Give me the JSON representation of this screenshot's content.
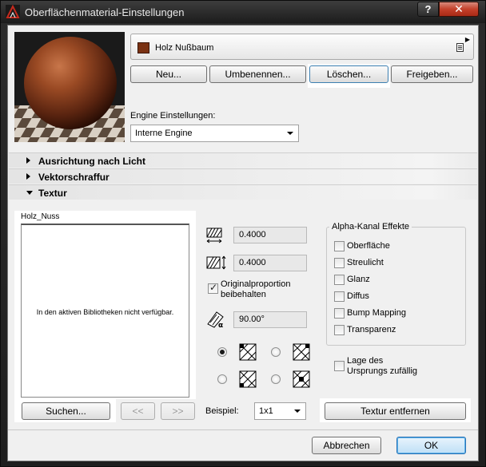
{
  "window": {
    "title": "Oberflächenmaterial-Einstellungen",
    "help_label": "?",
    "close_label": "✕"
  },
  "material": {
    "name": "Holz Nußbaum",
    "swatch_color": "#7a3213"
  },
  "buttons": {
    "new": "Neu...",
    "rename": "Umbenennen...",
    "delete": "Löschen...",
    "share": "Freigeben..."
  },
  "engine": {
    "label": "Engine Einstellungen:",
    "value": "Interne Engine"
  },
  "sections": [
    {
      "label": "Ausrichtung nach Licht",
      "expanded": false
    },
    {
      "label": "Vektorschraffur",
      "expanded": false
    },
    {
      "label": "Textur",
      "expanded": true
    }
  ],
  "texture": {
    "name": "Holz_Nuss",
    "message": "In den aktiven Bibliotheken nicht verfügbar.",
    "width_value": "0.4000",
    "height_value": "0.4000",
    "keep_proportion_label_1": "Originalproportion",
    "keep_proportion_label_2": "beibehalten",
    "keep_proportion_checked": true,
    "angle_value": "90.00°",
    "search_button": "Suchen...",
    "prev_button": "<<",
    "next_button": ">>",
    "example_label": "Beispiel:",
    "example_value": "1x1",
    "remove_button": "Textur entfernen"
  },
  "alpha": {
    "title": "Alpha-Kanal Effekte",
    "items": [
      "Oberfläche",
      "Streulicht",
      "Glanz",
      "Diffus",
      "Bump Mapping",
      "Transparenz"
    ]
  },
  "random_origin": {
    "label_1": "Lage des",
    "label_2": "Ursprungs zufällig"
  },
  "footer": {
    "cancel": "Abbrechen",
    "ok": "OK"
  }
}
